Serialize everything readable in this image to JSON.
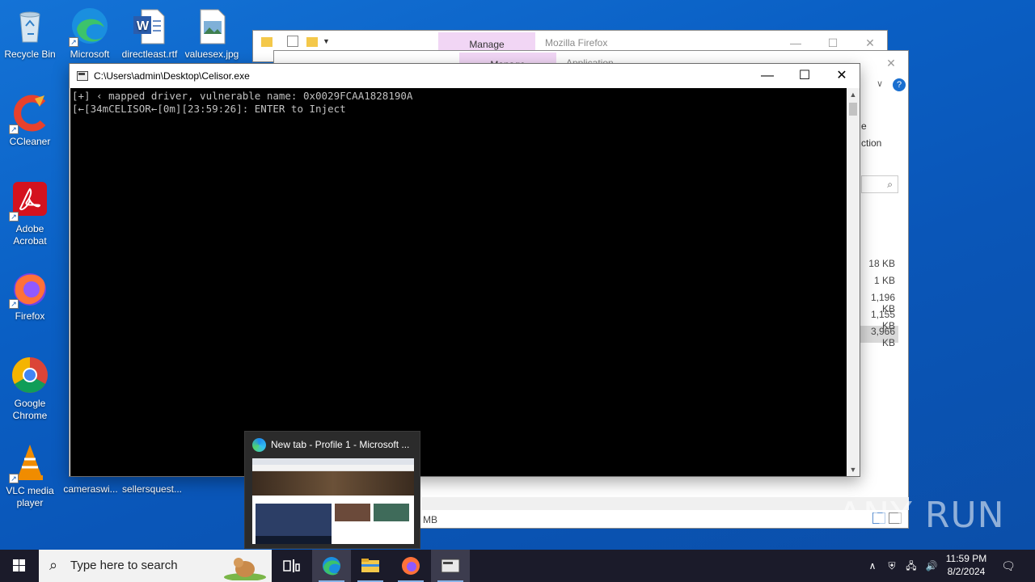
{
  "desktop_icons": [
    {
      "name": "recycle-bin",
      "label": "Recycle Bin"
    },
    {
      "name": "microsoft-edge",
      "label": "Microsoft Edge"
    },
    {
      "name": "directleast",
      "label": "directleast.rtf"
    },
    {
      "name": "valuesex",
      "label": "valuesex.jpg"
    },
    {
      "name": "ccleaner",
      "label": "CCleaner"
    },
    {
      "name": "adobe-acrobat",
      "label": "Adobe Acrobat"
    },
    {
      "name": "firefox",
      "label": "Firefox"
    },
    {
      "name": "google-chrome",
      "label": "Google Chrome"
    },
    {
      "name": "vlc",
      "label": "VLC media player"
    },
    {
      "name": "cameraswi",
      "label": "cameraswi..."
    },
    {
      "name": "sellersquest",
      "label": "sellersquest..."
    }
  ],
  "explorer_back": {
    "manage_tab": "Manage",
    "title": "Mozilla Firefox"
  },
  "explorer_front": {
    "manage_tab": "Manage",
    "title": "Application",
    "ribbon_fragment_1": "e",
    "ribbon_fragment_2": "ction",
    "file_sizes": [
      "18 KB",
      "1 KB",
      "1,196 KB",
      "1,155 KB",
      "3,966 KB"
    ],
    "status_size": "7 MB"
  },
  "console": {
    "title": "C:\\Users\\admin\\Desktop\\Celisor.exe",
    "lines": [
      "[+] ‹ mapped driver, vulnerable name: 0x0029FCAA1828190A",
      "[←[34mCELISOR←[0m][23:59:26]: ENTER to Inject"
    ]
  },
  "thumbnail": {
    "title": "New tab - Profile 1 - Microsoft ..."
  },
  "taskbar": {
    "search_placeholder": "Type here to search",
    "clock_time": "11:59 PM",
    "clock_date": "8/2/2024"
  },
  "watermark": "ANY RUN",
  "colors": {
    "desktop": "#0a5fc4",
    "taskbar": "#1b1b2a",
    "manage_tab": "#f1d6f5",
    "console_bg": "#000000"
  }
}
